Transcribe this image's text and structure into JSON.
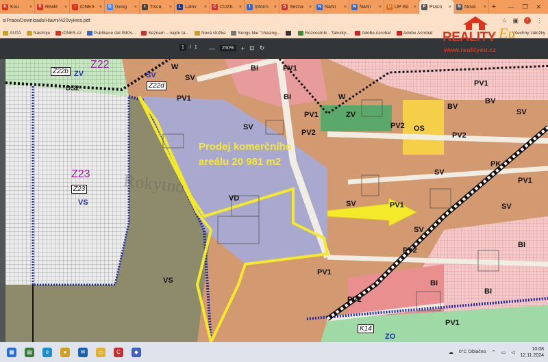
{
  "tabs": [
    {
      "label": "Kou",
      "color": "#e0311b",
      "glyph": "K"
    },
    {
      "label": "Realit",
      "color": "#e0311b",
      "glyph": "R"
    },
    {
      "label": "iDNES",
      "color": "#e0311b",
      "glyph": "i"
    },
    {
      "label": "Goog",
      "color": "#4285f4",
      "glyph": "G"
    },
    {
      "label": "Tisca",
      "color": "#444",
      "glyph": "t"
    },
    {
      "label": "Lidov",
      "color": "#1a3a8a",
      "glyph": "L"
    },
    {
      "label": "ČÚZK",
      "color": "#d03030",
      "glyph": "Č"
    },
    {
      "label": "Inform",
      "color": "#3366cc",
      "glyph": "I"
    },
    {
      "label": "Sezna",
      "color": "#cc3333",
      "glyph": "S"
    },
    {
      "label": "Nahlí",
      "color": "#3366cc",
      "glyph": "N"
    },
    {
      "label": "Nahlí",
      "color": "#3366cc",
      "glyph": "N"
    },
    {
      "label": "ÚP Ro",
      "color": "#e07020",
      "glyph": "Ú"
    },
    {
      "label": "Praco",
      "color": "#555",
      "glyph": "P"
    },
    {
      "label": "Nová",
      "color": "#555",
      "glyph": "N"
    }
  ],
  "window": {
    "minimize": "—",
    "restore": "❐",
    "close": "✕",
    "new_tab": "+"
  },
  "address": {
    "url": "s/Prace/Downloads/Hlavni%20vykres.pdf"
  },
  "bookmarks": [
    {
      "label": "AUTA",
      "color": "#c9a227"
    },
    {
      "label": "Nástroje",
      "color": "#c9a227"
    },
    {
      "label": "iDNES.cz",
      "color": "#e0311b"
    },
    {
      "label": "Publikace dat ISKN...",
      "color": "#3366cc"
    },
    {
      "label": "Seznam – najdu ta...",
      "color": "#cc3333"
    },
    {
      "label": "Nová složka",
      "color": "#c9a227"
    },
    {
      "label": "Songs like \"chasing...",
      "color": "#777"
    },
    {
      "label": "",
      "color": "#333"
    },
    {
      "label": "Rozcestník - Tabulky...",
      "color": "#3a8a3a"
    },
    {
      "label": "Adobe Acrobat",
      "color": "#d02020"
    },
    {
      "label": "Adobe Acrobat",
      "color": "#d02020"
    }
  ],
  "bookmarks_right": "Všechny záložky",
  "pdf": {
    "page_current": "1",
    "page_sep": "/",
    "page_total": "1",
    "zoom": "250%",
    "zoom_out": "—",
    "zoom_in": "+"
  },
  "logo": {
    "main": "REALITY",
    "script": "Eu",
    "web": "www.realityeu.cz"
  },
  "map": {
    "annotation_line1": "Prodej komerčního",
    "annotation_line2": "areálu 20 981 m2",
    "place_name": "Rokytno",
    "labels": [
      {
        "id": "bi-1",
        "text": "BI"
      },
      {
        "id": "pv1-1",
        "text": "PV1"
      },
      {
        "id": "w-1",
        "text": "W"
      },
      {
        "id": "sv-1",
        "text": "SV"
      },
      {
        "id": "pv1-2",
        "text": "PV1"
      },
      {
        "id": "bi-2",
        "text": "BI"
      },
      {
        "id": "w-2",
        "text": "W"
      },
      {
        "id": "zv-1",
        "text": "ZV"
      },
      {
        "id": "pv2-1",
        "text": "PV2"
      },
      {
        "id": "os-1",
        "text": "OS"
      },
      {
        "id": "bv-1",
        "text": "BV"
      },
      {
        "id": "bv-2",
        "text": "BV"
      },
      {
        "id": "sv-2",
        "text": "SV"
      },
      {
        "id": "pv1-3",
        "text": "PV1"
      },
      {
        "id": "pv1-4",
        "text": "PV1"
      },
      {
        "id": "sv-3",
        "text": "SV"
      },
      {
        "id": "pv2-2",
        "text": "PV2"
      },
      {
        "id": "pv2-3",
        "text": "PV2"
      },
      {
        "id": "sv-4",
        "text": "SV"
      },
      {
        "id": "pk-1",
        "text": "PK"
      },
      {
        "id": "pv1-5",
        "text": "PV1"
      },
      {
        "id": "vd-1",
        "text": "VD"
      },
      {
        "id": "sv-5",
        "text": "SV"
      },
      {
        "id": "pv1-6",
        "text": "PV1"
      },
      {
        "id": "sv-6",
        "text": "SV"
      },
      {
        "id": "sv-7",
        "text": "SV"
      },
      {
        "id": "bi-3",
        "text": "BI"
      },
      {
        "id": "pv2-4",
        "text": "PV2"
      },
      {
        "id": "pv1-7",
        "text": "PV1"
      },
      {
        "id": "vs-1",
        "text": "VS"
      },
      {
        "id": "pv2-5",
        "text": "PV2"
      },
      {
        "id": "bi-4",
        "text": "BI"
      },
      {
        "id": "bi-5",
        "text": "BI"
      },
      {
        "id": "pv1-8",
        "text": "PV1"
      },
      {
        "id": "zo-1",
        "text": "ZO"
      },
      {
        "id": "sv-8",
        "text": "SV"
      },
      {
        "id": "vs-2",
        "text": "VS"
      },
      {
        "id": "zv-2",
        "text": "ZV"
      },
      {
        "id": "ds2",
        "text": "DS2"
      }
    ],
    "zone_labels": [
      {
        "id": "z22",
        "text": "Z22"
      },
      {
        "id": "z23",
        "text": "Z23"
      }
    ],
    "box_labels": [
      {
        "id": "z22b",
        "text": "Z22b"
      },
      {
        "id": "z22d",
        "text": "Z22d"
      },
      {
        "id": "z23box",
        "text": "Z23"
      },
      {
        "id": "k14",
        "text": "K14"
      }
    ]
  },
  "taskbar": {
    "weather": "0°C  Oblačno",
    "time": "10:08",
    "date": "12.11.2024",
    "icons": [
      {
        "name": "start",
        "color": "#2b6cd1",
        "glyph": "▦"
      },
      {
        "name": "widgets",
        "color": "#3b7a3b",
        "glyph": "▤"
      },
      {
        "name": "edge",
        "color": "#1a8fd0",
        "glyph": "e"
      },
      {
        "name": "chrome",
        "color": "#d0a020",
        "glyph": "●"
      },
      {
        "name": "mail",
        "color": "#1a5fb0",
        "glyph": "✉"
      },
      {
        "name": "explorer",
        "color": "#e0b030",
        "glyph": "▭"
      },
      {
        "name": "ccleaner",
        "color": "#c03030",
        "glyph": "C"
      },
      {
        "name": "store",
        "color": "#4060c0",
        "glyph": "◆"
      }
    ]
  }
}
